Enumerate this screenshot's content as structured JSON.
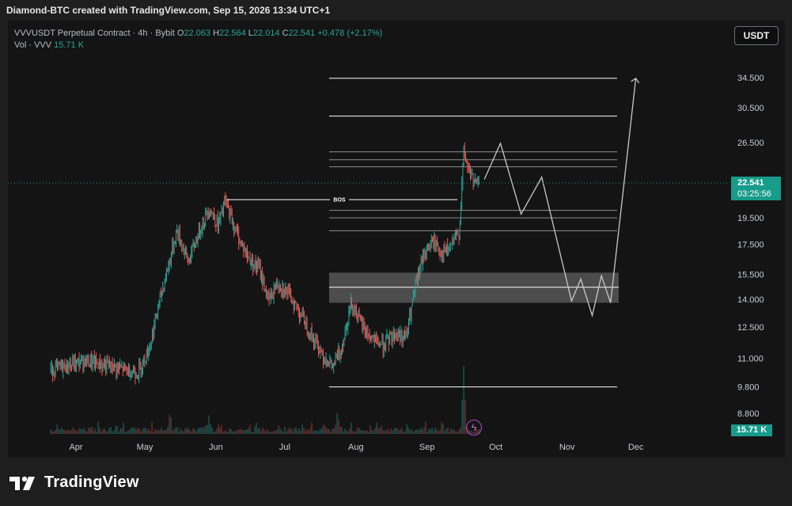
{
  "caption": "Diamond-BTC created with TradingView.com, Sep 15, 2026 13:34 UTC+1",
  "legend": {
    "symbol": "VVVUSDT Perpetual Contract · 4h · Bybit",
    "open_label": "O",
    "open": "22.063",
    "high_label": "H",
    "high": "22.564",
    "low_label": "L",
    "low": "22.014",
    "close_label": "C",
    "close": "22.541",
    "change": "+0.478 (+2.17%)",
    "vol_label": "Vol · VVV",
    "vol_value": "15.71 K"
  },
  "currency_button": "USDT",
  "price_tag": {
    "price": "22.541",
    "countdown": "03:25:56"
  },
  "volume_tag": "15.71 K",
  "brand": {
    "name": "TradingView"
  },
  "colors": {
    "up": "#26a69a",
    "down": "#ef5350",
    "background": "#141414",
    "accent": "#179b8a",
    "projection": "#c8c8c8"
  },
  "chart_data": {
    "type": "candlestick",
    "timeframe": "4h",
    "scale": "log",
    "y_ticks": [
      34.5,
      30.5,
      26.5,
      19.5,
      17.5,
      15.5,
      14.0,
      12.5,
      11.0,
      9.8,
      8.8
    ],
    "y_tick_labels": [
      "34.500",
      "30.500",
      "26.500",
      "19.500",
      "17.500",
      "15.500",
      "14.000",
      "12.500",
      "11.000",
      "9.800",
      "8.800"
    ],
    "x_ticks": [
      {
        "label": "Apr",
        "date": "2026-04-01"
      },
      {
        "label": "May",
        "date": "2026-05-01"
      },
      {
        "label": "Jun",
        "date": "2026-06-01"
      },
      {
        "label": "Jul",
        "date": "2026-07-01"
      },
      {
        "label": "Aug",
        "date": "2026-08-01"
      },
      {
        "label": "Sep",
        "date": "2026-09-01"
      },
      {
        "label": "Oct",
        "date": "2026-10-01"
      },
      {
        "label": "Nov",
        "date": "2026-11-01"
      },
      {
        "label": "Dec",
        "date": "2026-12-01"
      }
    ],
    "price_path": [
      {
        "date": "2026-03-21",
        "price": 10.5
      },
      {
        "date": "2026-04-05",
        "price": 10.9
      },
      {
        "date": "2026-04-18",
        "price": 10.6
      },
      {
        "date": "2026-04-28",
        "price": 10.4
      },
      {
        "date": "2026-05-03",
        "price": 11.5
      },
      {
        "date": "2026-05-08",
        "price": 14.2
      },
      {
        "date": "2026-05-12",
        "price": 16.5
      },
      {
        "date": "2026-05-15",
        "price": 18.5
      },
      {
        "date": "2026-05-20",
        "price": 16.3
      },
      {
        "date": "2026-05-25",
        "price": 18.6
      },
      {
        "date": "2026-05-29",
        "price": 20.3
      },
      {
        "date": "2026-06-02",
        "price": 18.9
      },
      {
        "date": "2026-06-05",
        "price": 20.9
      },
      {
        "date": "2026-06-10",
        "price": 18.3
      },
      {
        "date": "2026-06-15",
        "price": 16.6
      },
      {
        "date": "2026-06-20",
        "price": 15.8
      },
      {
        "date": "2026-06-24",
        "price": 13.9
      },
      {
        "date": "2026-06-28",
        "price": 15.0
      },
      {
        "date": "2026-07-03",
        "price": 14.2
      },
      {
        "date": "2026-07-08",
        "price": 13.2
      },
      {
        "date": "2026-07-13",
        "price": 12.0
      },
      {
        "date": "2026-07-18",
        "price": 11.1
      },
      {
        "date": "2026-07-22",
        "price": 10.6
      },
      {
        "date": "2026-07-26",
        "price": 11.6
      },
      {
        "date": "2026-07-30",
        "price": 13.9
      },
      {
        "date": "2026-08-03",
        "price": 12.7
      },
      {
        "date": "2026-08-08",
        "price": 11.9
      },
      {
        "date": "2026-08-13",
        "price": 11.6
      },
      {
        "date": "2026-08-18",
        "price": 12.2
      },
      {
        "date": "2026-08-23",
        "price": 12.0
      },
      {
        "date": "2026-08-27",
        "price": 14.8
      },
      {
        "date": "2026-08-31",
        "price": 17.0
      },
      {
        "date": "2026-09-04",
        "price": 17.7
      },
      {
        "date": "2026-09-08",
        "price": 16.8
      },
      {
        "date": "2026-09-12",
        "price": 17.5
      },
      {
        "date": "2026-09-15",
        "price": 18.4
      },
      {
        "date": "2026-09-17",
        "price": 25.5
      },
      {
        "date": "2026-09-19",
        "price": 23.8
      },
      {
        "date": "2026-09-22",
        "price": 22.3
      },
      {
        "date": "2026-09-24",
        "price": 22.5
      }
    ],
    "volume_peaks": [
      {
        "date": "2026-05-12",
        "rel": 0.35
      },
      {
        "date": "2026-05-29",
        "rel": 0.28
      },
      {
        "date": "2026-07-24",
        "rel": 0.35
      },
      {
        "date": "2026-09-17",
        "rel": 1.0
      }
    ],
    "horizontal_levels": [
      34.4,
      29.5,
      25.5,
      24.7,
      24.0,
      20.1,
      19.5,
      18.5,
      9.8
    ],
    "bos_level": 21.0,
    "annotations": [
      "BOS"
    ],
    "demand_zone": [
      13.8,
      15.6
    ],
    "demand_zone_mid": 14.7,
    "projection_path": [
      {
        "date": "2026-09-26",
        "price": 22.8
      },
      {
        "date": "2026-10-03",
        "price": 26.4
      },
      {
        "date": "2026-10-12",
        "price": 19.8
      },
      {
        "date": "2026-10-21",
        "price": 23.0
      },
      {
        "date": "2026-11-03",
        "price": 13.9
      },
      {
        "date": "2026-11-07",
        "price": 15.2
      },
      {
        "date": "2026-11-12",
        "price": 13.1
      },
      {
        "date": "2026-11-16",
        "price": 15.4
      },
      {
        "date": "2026-11-20",
        "price": 13.8
      },
      {
        "date": "2026-12-01",
        "price": 34.4
      }
    ]
  }
}
